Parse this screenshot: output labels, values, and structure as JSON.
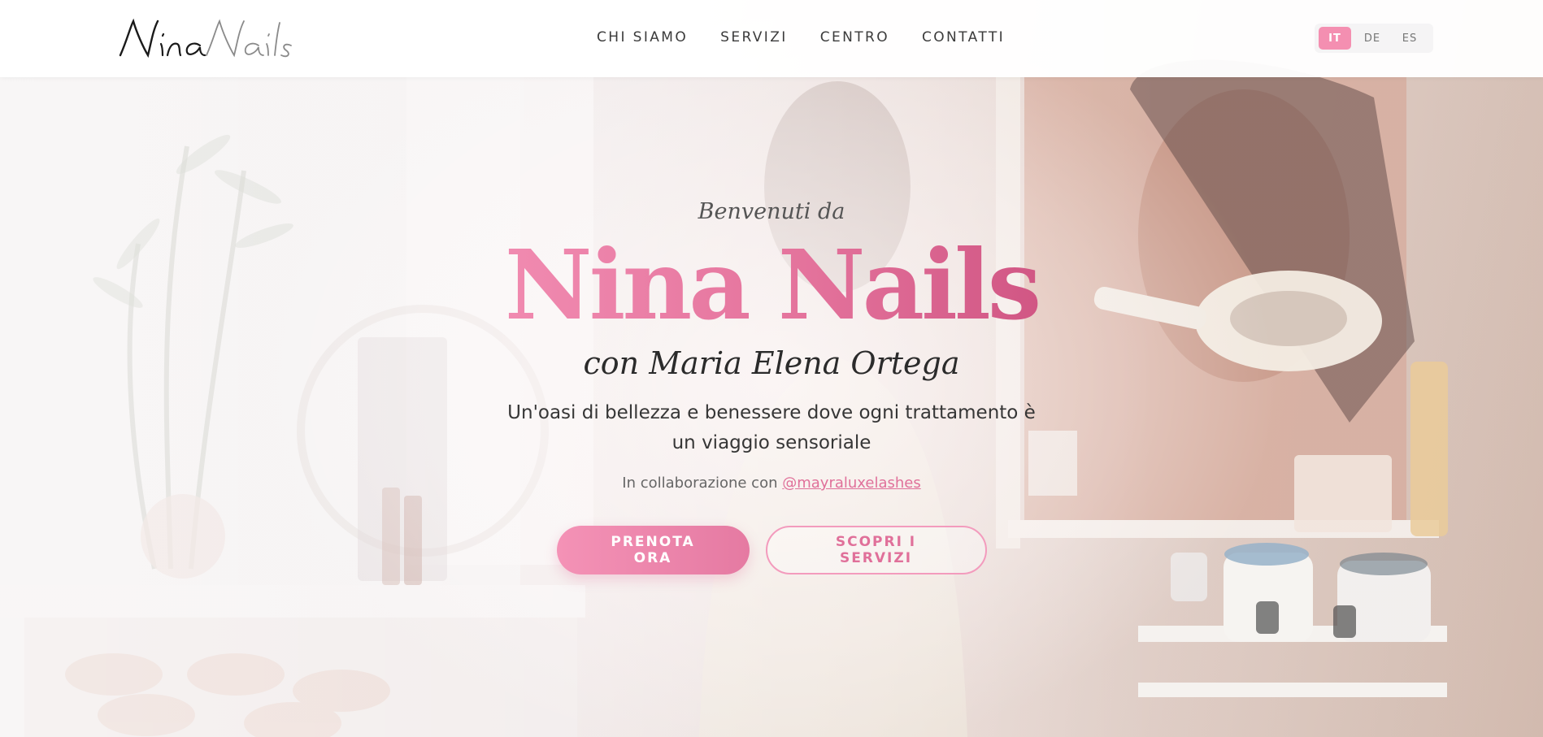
{
  "header": {
    "logo": "Nina Nails",
    "nav": [
      "CHI SIAMO",
      "SERVIZI",
      "CENTRO",
      "CONTATTI"
    ],
    "languages": [
      "IT",
      "DE",
      "ES"
    ],
    "active_language": "IT"
  },
  "hero": {
    "welcome": "Benvenuti da",
    "title": "Nina Nails",
    "subtitle": "con Maria Elena Ortega",
    "tagline": "Un'oasi di bellezza e benessere dove ogni trattamento è un viaggio sensoriale",
    "collab_prefix": "In collaborazione con",
    "collab_handle": "@mayraluxelashes",
    "primary_button": "PRENOTA ORA",
    "secondary_button": "SCOPRI I SERVIZI"
  },
  "colors": {
    "accent": "#e57aa2",
    "accent_light": "#f48fb1",
    "text_dark": "#2b2b2b",
    "header_bg": "#ffffff"
  }
}
